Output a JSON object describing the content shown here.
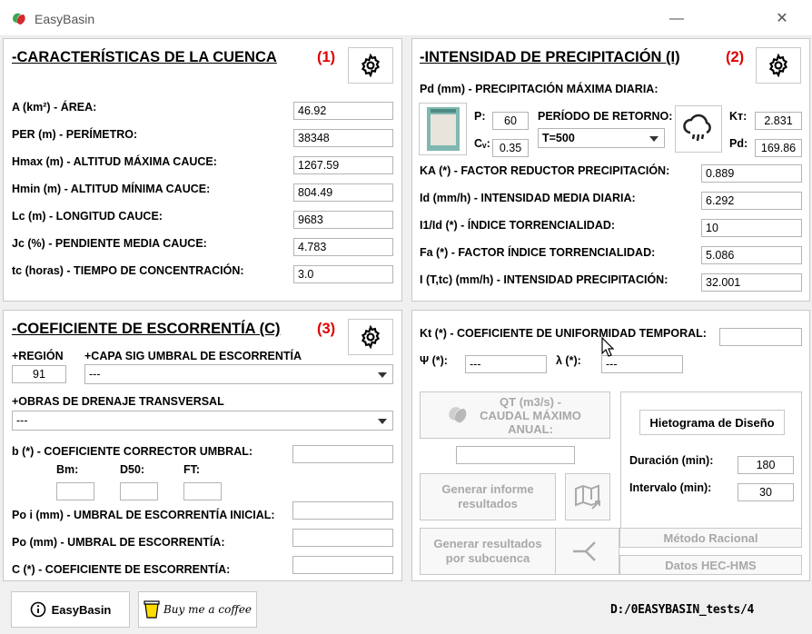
{
  "window": {
    "title": "EasyBasin",
    "minimize": "—",
    "close": "✕"
  },
  "basin": {
    "title": "-CARACTERÍSTICAS DE LA CUENCA",
    "number": "(1)",
    "fields": [
      {
        "label": "A (km²) - ÁREA:",
        "value": "46.92"
      },
      {
        "label": "PER (m) - PERÍMETRO:",
        "value": "38348"
      },
      {
        "label": "Hmax (m) - ALTITUD MÁXIMA CAUCE:",
        "value": "1267.59"
      },
      {
        "label": "Hmin (m) - ALTITUD MÍNIMA CAUCE:",
        "value": "804.49"
      },
      {
        "label": "Lc (m) - LONGITUD CAUCE:",
        "value": "9683"
      },
      {
        "label": "Jc (%) - PENDIENTE MEDIA CAUCE:",
        "value": "4.783"
      },
      {
        "label": "tc (horas) - TIEMPO DE CONCENTRACIÓN:",
        "value": "3.0"
      }
    ]
  },
  "precip": {
    "title": "-INTENSIDAD DE PRECIPITACIÓN (I)",
    "number": "(2)",
    "pd_header": "Pd (mm) - PRECIPITACIÓN MÁXIMA DIARIA:",
    "p_label": "P:",
    "p_value": "60",
    "cv_label": "Cᵥ:",
    "cv_value": "0.35",
    "return_label": "PERÍODO DE RETORNO:",
    "return_value": "T=500",
    "kt_label": "Kᴛ:",
    "kt_value": "2.831",
    "pd_label": "Pd:",
    "pd_value": "169.86",
    "fields": [
      {
        "label": "KA (*) - FACTOR REDUCTOR PRECIPITACIÓN:",
        "value": "0.889"
      },
      {
        "label": "Id (mm/h) - INTENSIDAD MEDIA DIARIA:",
        "value": "6.292"
      },
      {
        "label": "I1/Id (*) - ÍNDICE TORRENCIALIDAD:",
        "value": "10"
      },
      {
        "label": "Fa (*) - FACTOR ÍNDICE TORRENCIALIDAD:",
        "value": "5.086"
      },
      {
        "label": "I (T,tc) (mm/h) - INTENSIDAD PRECIPITACIÓN:",
        "value": "32.001"
      }
    ]
  },
  "runoff": {
    "title": "-COEFICIENTE DE ESCORRENTÍA (C)",
    "number": "(3)",
    "region_label": "+REGIÓN",
    "region_value": "91",
    "sig_label": "+CAPA SIG UMBRAL DE ESCORRENTÍA",
    "sig_value": "---",
    "obras_label": "+OBRAS DE DRENAJE TRANSVERSAL",
    "obras_value": "---",
    "b_label": "b (*) - COEFICIENTE CORRECTOR UMBRAL:",
    "bm_label": "Bm:",
    "d50_label": "D50:",
    "ft_label": "FT:",
    "poi_label": "Po i (mm) - UMBRAL DE ESCORRENTÍA INICIAL:",
    "po_label": "Po (mm) - UMBRAL DE ESCORRENTÍA:",
    "c_label": "C (*) - COEFICIENTE DE ESCORRENTÍA:"
  },
  "results": {
    "kt_label": "Kt (*) - COEFICIENTE DE UNIFORMIDAD TEMPORAL:",
    "psi_label": "Ψ (*):",
    "psi_value": "---",
    "lambda_label": "λ (*):",
    "lambda_value": "---",
    "qt_button": "QT (m3/s) - CAUDAL MÁXIMO ANUAL:",
    "hietograma_button": "Hietograma de Diseño",
    "duration_label": "Duración (min):",
    "duration_value": "180",
    "interval_label": "Intervalo (min):",
    "interval_value": "30",
    "informe_button": "Generar informe resultados",
    "subcuenca_button": "Generar resultados por subcuenca",
    "racional_button": "Método Racional",
    "hechms_button": "Datos HEC-HMS"
  },
  "footer": {
    "about_button": "EasyBasin",
    "coffee_button": "Buy me a coffee",
    "path": "D:/0EASYBASIN_tests/4"
  }
}
